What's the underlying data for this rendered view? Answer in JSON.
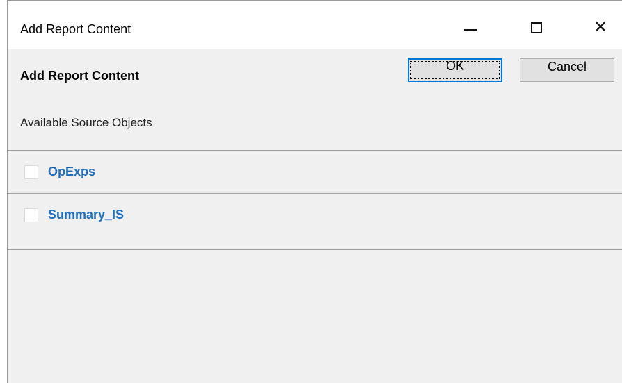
{
  "window": {
    "title": "Add Report Content",
    "minimize_icon": "minimize-icon",
    "maximize_icon": "maximize-icon",
    "close_icon": "close-icon",
    "close_glyph": "✕"
  },
  "dialog": {
    "heading": "Add Report Content",
    "ok_label": "OK",
    "cancel_mnemonic": "C",
    "cancel_rest": "ancel",
    "section_label": "Available Source Objects"
  },
  "source_objects": [
    {
      "label": "OpExps",
      "checked": false
    },
    {
      "label": "Summary_IS",
      "checked": false
    }
  ],
  "colors": {
    "accent": "#0078d7",
    "link_text": "#1e6fc0",
    "dialog_background": "#f0f0f0"
  }
}
